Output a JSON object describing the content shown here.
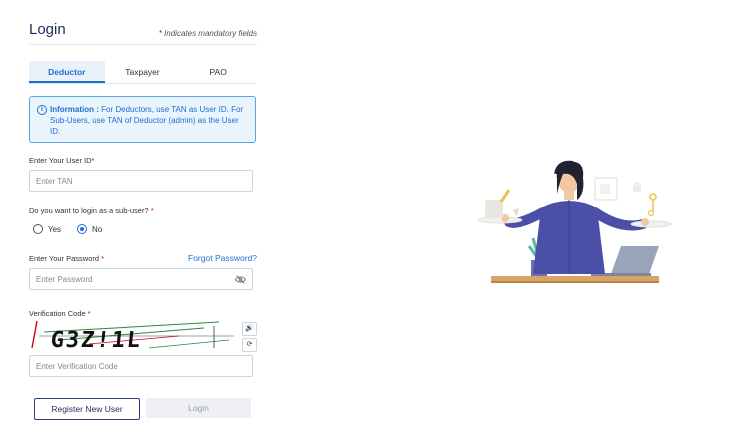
{
  "login": {
    "title": "Login",
    "mandatory_star": "*",
    "mandatory_text": "Indicates mandatory fields",
    "tabs": [
      {
        "label": "Deductor",
        "active": true
      },
      {
        "label": "Taxpayer",
        "active": false
      },
      {
        "label": "PAO",
        "active": false
      }
    ],
    "info_label": "Information :",
    "info_text": "For Deductors, use TAN as User ID. For Sub-Users, use TAN of Deductor (admin) as the User ID.",
    "user_id_label": "Enter Your User ID",
    "user_id_placeholder": "Enter TAN",
    "subuser_label": "Do you want to login as a sub-user?",
    "radio_yes": "Yes",
    "radio_no": "No",
    "password_label": "Enter Your Password",
    "forgot_password": "Forgot Password?",
    "password_placeholder": "Enter Password",
    "verification_label": "Verification Code",
    "captcha_text": "G3Z!1L",
    "verification_placeholder": "Enter Verification Code",
    "register_button": "Register New User",
    "login_button": "Login"
  },
  "colors": {
    "brand": "#1e2a5a",
    "accent": "#1c6fd1",
    "required": "#d0021b"
  },
  "icons": [
    "info-icon",
    "eye-slash-icon",
    "audio-icon",
    "refresh-icon"
  ]
}
